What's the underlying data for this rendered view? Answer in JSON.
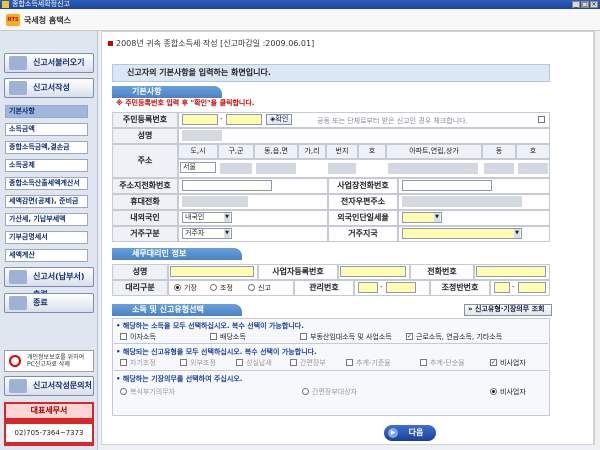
{
  "window": {
    "title": "종합소득세확정신고",
    "min": "_",
    "max": "□",
    "close": "×"
  },
  "topbar": {
    "logo_text": "국세청 홈택스",
    "logo_mark": "NTS"
  },
  "sidebar": {
    "load_btn": "신고서불러오기",
    "write_btn": "신고서작성",
    "items": [
      "기본사항",
      "소득금액",
      "종합소득금액,결손금",
      "소득공제",
      "종합소득산출세액계산서",
      "세액감면(공제), 준비금",
      "가산세, 기납부세액",
      "기부금명세서",
      "세액계산"
    ],
    "submit_btn": "신고서(납부서) 출력",
    "exit_btn": "종료",
    "pc_note": "개인정보보호를 위하여 PC신고자료 삭제",
    "help_btn": "신고서작성문의처",
    "office_name": "대표세무서",
    "office_tel": "02)705-7364~7373"
  },
  "header": {
    "notice": "2008년 귀속 종합소득세 작성 [신고마감일 :2009.06.01]"
  },
  "page_title": "신고자의 기본사항을 입력하는 화면입니다.",
  "basic": {
    "section": "기본사항",
    "warning": "※ 주민등록번호 입력 후 \"확인\"을 클릭합니다.",
    "rrn_label": "주민등록번호",
    "confirm_btn": "확인",
    "joint_note": "공동 또는 단체로부터 받은 신고인 경우 체크합니다.",
    "name_label": "성명",
    "address_label": "주소",
    "addr_headers": [
      "도,시",
      "구,군",
      "동,읍,면",
      "가,리",
      "번지",
      "호",
      "아파트,연립,상가",
      "동",
      "호"
    ],
    "addr_city": "서울",
    "home_phone_label": "주소지전화번호",
    "biz_phone_label": "사업장전화번호",
    "mobile_label": "휴대전화",
    "email_label": "전자우편주소",
    "resident_label": "내외국인",
    "resident_value": "내국인",
    "foreign_tax_label": "외국인단일세율",
    "residence_label": "거주구분",
    "residence_value": "거주자",
    "residence_region_label": "거주지국"
  },
  "agent": {
    "section": "세무대리인 정보",
    "name_label": "성명",
    "biz_reg_label": "사업자등록번호",
    "phone_label": "전화번호",
    "type_label": "대리구분",
    "type_options": [
      "기장",
      "조정",
      "신고"
    ],
    "mgmt_no_label": "관리번호",
    "adj_no_label": "조정반번호",
    "dash": "-"
  },
  "income": {
    "section": "소득 및 신고유형선택",
    "guide_btn": "신고유형·기장의무 조회",
    "q1": "• 해당하는 소득을 모두 선택하십시오. 복수 선택이 가능합니다.",
    "q1_options": [
      "이자소득",
      "배당소득",
      "부동산임대소득 및 사업소득",
      "근로소득, 연금소득, 기타소득"
    ],
    "q2": "• 해당되는 신고유형을 모두 선택하십시오. 복수 선택이 가능합니다.",
    "q2_options": [
      "자기조정",
      "외부조정",
      "성실납세",
      "간편장부",
      "추계-기준율",
      "추계-단순율",
      "비사업자"
    ],
    "q3": "• 해당하는 기장의무를 선택하여 주십시오.",
    "q3_options": [
      "복식부기의무자",
      "간편장부대상자",
      "비사업자"
    ]
  },
  "next_btn": "다음"
}
